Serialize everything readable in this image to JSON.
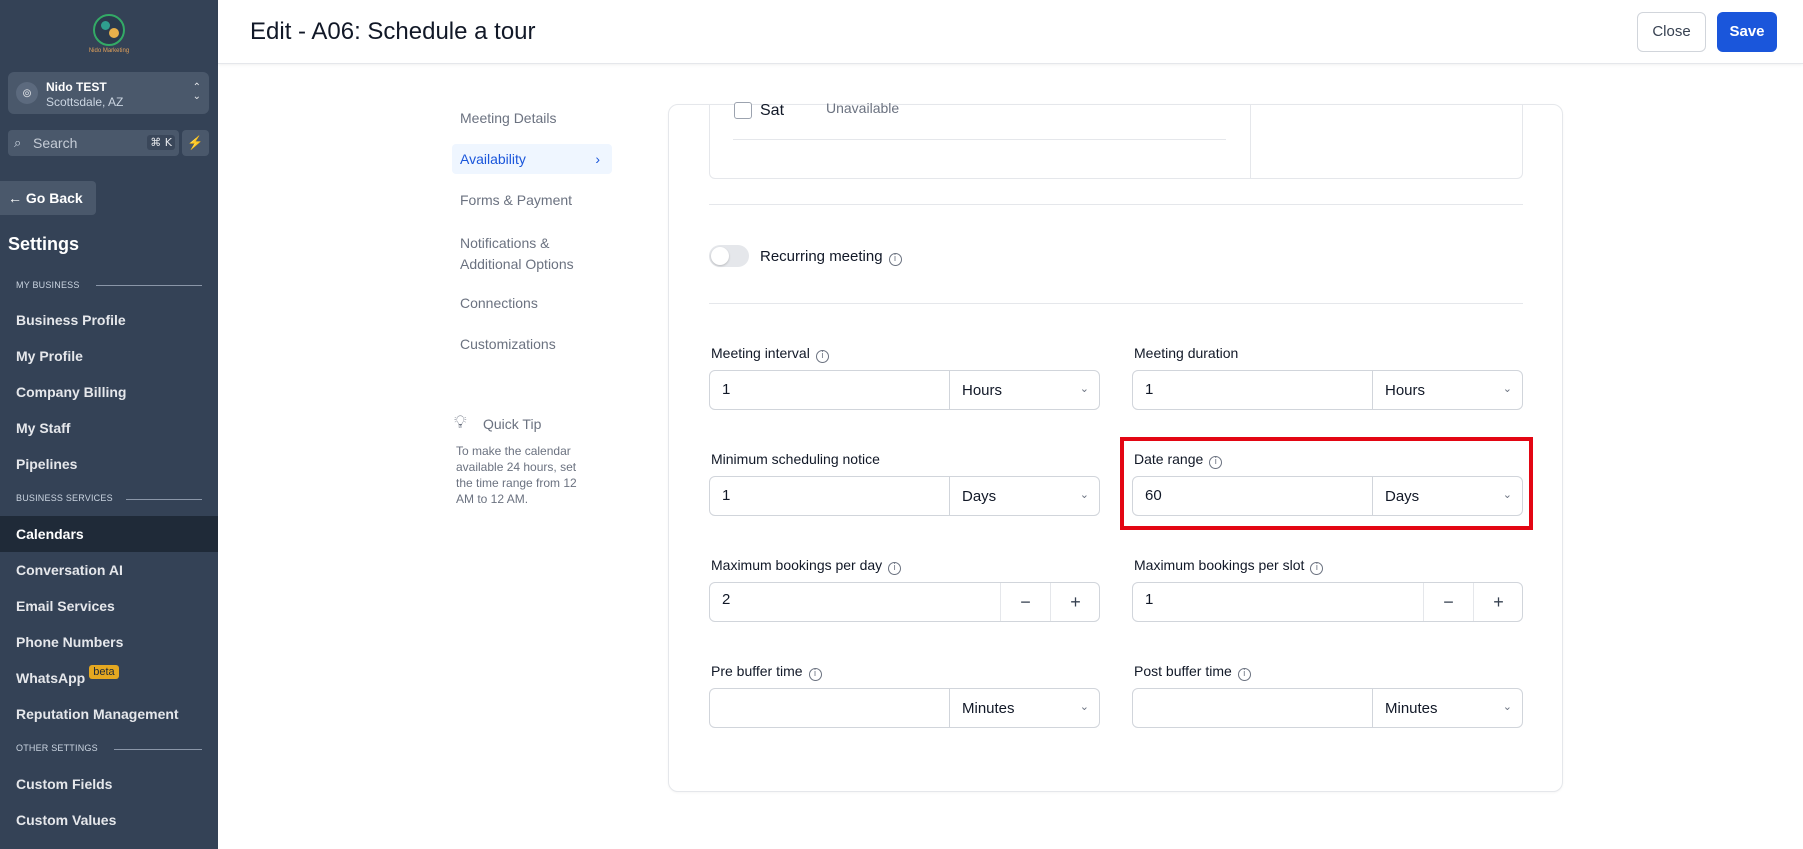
{
  "sidebar": {
    "logo_text": "Nido Marketing",
    "account": {
      "avatar": "⊚",
      "name": "Nido TEST",
      "location": "Scottsdale, AZ"
    },
    "search": {
      "placeholder": "Search",
      "shortcut": "⌘ K"
    },
    "go_back": "Go Back",
    "title": "Settings",
    "sections": {
      "my_business": "MY BUSINESS",
      "business_services": "BUSINESS SERVICES",
      "other_settings": "OTHER SETTINGS"
    },
    "items": {
      "business_profile": "Business Profile",
      "my_profile": "My Profile",
      "company_billing": "Company Billing",
      "my_staff": "My Staff",
      "pipelines": "Pipelines",
      "calendars": "Calendars",
      "conversation_ai": "Conversation AI",
      "email_services": "Email Services",
      "phone_numbers": "Phone Numbers",
      "whatsapp": "WhatsApp",
      "whatsapp_badge": "beta",
      "reputation_management": "Reputation Management",
      "custom_fields": "Custom Fields",
      "custom_values": "Custom Values"
    },
    "active_item": "Calendars"
  },
  "header": {
    "title": "Edit - A06: Schedule a tour",
    "close_label": "Close",
    "save_label": "Save"
  },
  "tabs": {
    "meeting_details": "Meeting Details",
    "availability": "Availability",
    "forms_payment": "Forms & Payment",
    "notifications": "Notifications & Additional Options",
    "connections": "Connections",
    "customizations": "Customizations",
    "active": "Availability"
  },
  "quick_tip": {
    "title": "Quick Tip",
    "text": "To make the calendar available 24 hours, set the time range from 12 AM to 12 AM."
  },
  "availability": {
    "day": "Sat",
    "status": "Unavailable",
    "checked": false
  },
  "recurring": {
    "label": "Recurring meeting",
    "enabled": false
  },
  "fields": {
    "meeting_interval": {
      "label": "Meeting interval",
      "value": "1",
      "unit": "Hours"
    },
    "meeting_duration": {
      "label": "Meeting duration",
      "value": "1",
      "unit": "Hours"
    },
    "min_notice": {
      "label": "Minimum scheduling notice",
      "value": "1",
      "unit": "Days"
    },
    "date_range": {
      "label": "Date range",
      "value": "60",
      "unit": "Days"
    },
    "max_per_day": {
      "label": "Maximum bookings per day",
      "value": "2"
    },
    "max_per_slot": {
      "label": "Maximum bookings per slot",
      "value": "1"
    },
    "pre_buffer": {
      "label": "Pre buffer time",
      "value": "",
      "unit": "Minutes"
    },
    "post_buffer": {
      "label": "Post buffer time",
      "value": "",
      "unit": "Minutes"
    }
  },
  "colors": {
    "sidebar_bg": "#344256",
    "primary": "#1a56db",
    "highlight": "#e30613"
  }
}
